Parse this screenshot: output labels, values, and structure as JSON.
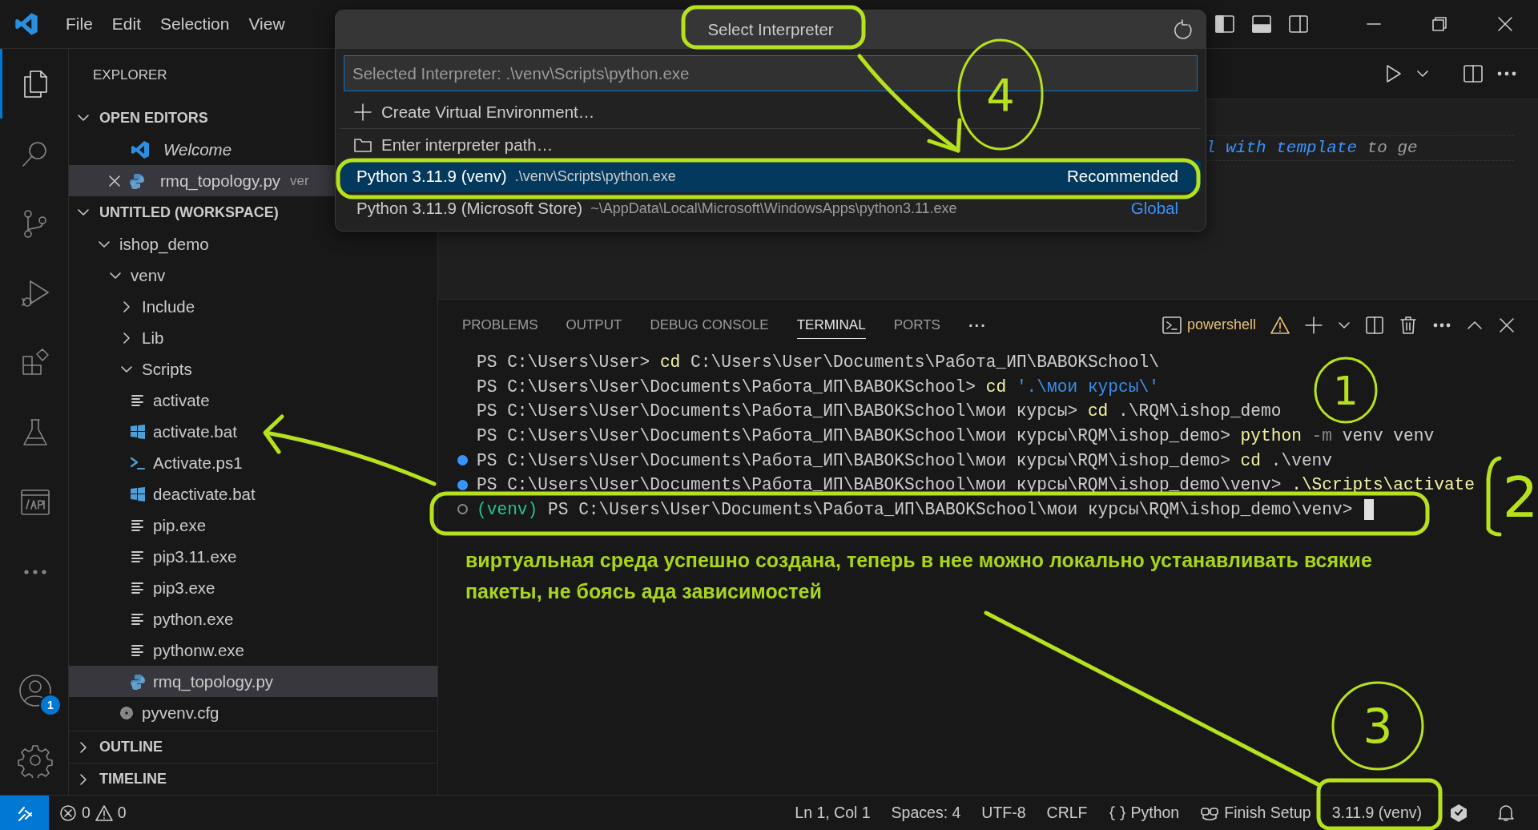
{
  "title_bar": {
    "menu": [
      "File",
      "Edit",
      "Selection",
      "View"
    ]
  },
  "activity_bar": {
    "items": [
      {
        "selected": true
      },
      {
        "selected": false
      },
      {
        "selected": false
      },
      {
        "selected": false
      },
      {
        "selected": false
      },
      {
        "selected": false
      },
      {
        "selected": false
      },
      {
        "selected": false
      }
    ],
    "accounts_badge": "1"
  },
  "sidebar": {
    "title": "EXPLORER",
    "open_editors": {
      "title": "OPEN EDITORS",
      "expanded": true,
      "items": [
        {
          "label": "Welcome",
          "kind": "welcome",
          "italic": true,
          "closable": false,
          "selected": false
        },
        {
          "label": "rmq_topology.py",
          "kind": "python",
          "description": "ver",
          "italic": false,
          "closable": true,
          "selected": true
        }
      ]
    },
    "workspace": {
      "title": "UNTITLED (WORKSPACE)",
      "expanded": true,
      "tree": [
        {
          "label": "ishop_demo",
          "kind": "folder",
          "expanded": true,
          "selected": false,
          "children": [
            {
              "label": "venv",
              "kind": "folder",
              "expanded": true,
              "selected": false,
              "children": [
                {
                  "label": "Include",
                  "kind": "folder",
                  "expanded": false,
                  "selected": false
                },
                {
                  "label": "Lib",
                  "kind": "folder",
                  "expanded": false,
                  "selected": false
                },
                {
                  "label": "Scripts",
                  "kind": "folder",
                  "expanded": true,
                  "selected": false,
                  "children": [
                    {
                      "label": "activate",
                      "kind": "text",
                      "selected": false
                    },
                    {
                      "label": "activate.bat",
                      "kind": "windows",
                      "selected": false
                    },
                    {
                      "label": "Activate.ps1",
                      "kind": "powershell",
                      "selected": false
                    },
                    {
                      "label": "deactivate.bat",
                      "kind": "windows",
                      "selected": false
                    },
                    {
                      "label": "pip.exe",
                      "kind": "text",
                      "selected": false
                    },
                    {
                      "label": "pip3.11.exe",
                      "kind": "text",
                      "selected": false
                    },
                    {
                      "label": "pip3.exe",
                      "kind": "text",
                      "selected": false
                    },
                    {
                      "label": "python.exe",
                      "kind": "text",
                      "selected": false
                    },
                    {
                      "label": "pythonw.exe",
                      "kind": "text",
                      "selected": false
                    },
                    {
                      "label": "rmq_topology.py",
                      "kind": "python",
                      "selected": true
                    }
                  ]
                },
                {
                  "label": "pyvenv.cfg",
                  "kind": "config",
                  "selected": false
                }
              ]
            }
          ]
        }
      ]
    },
    "collapsed_sections": [
      {
        "title": "OUTLINE",
        "expanded": false
      },
      {
        "title": "TIMELINE",
        "expanded": false
      }
    ]
  },
  "editor": {
    "visible_text": [
      {
        "kind": "emphasis",
        "text": "l with template"
      },
      {
        "kind": "plain",
        "text": " to ge"
      }
    ]
  },
  "quick_pick": {
    "title": "Select Interpreter",
    "placeholder": "Selected Interpreter: .\\venv\\Scripts\\python.exe",
    "items": [
      {
        "kind": "create",
        "label": "Create Virtual Environment…",
        "selected": false
      },
      {
        "kind": "browse",
        "label": "Enter interpreter path…",
        "selected": false
      },
      {
        "kind": "interpreter",
        "label": "Python 3.11.9 (venv)",
        "detail": ".\\venv\\Scripts\\python.exe",
        "badge": "Recommended",
        "selected": true
      },
      {
        "kind": "interpreter",
        "label": "Python 3.11.9 (Microsoft Store)",
        "detail": "~\\AppData\\Local\\Microsoft\\WindowsApps\\python3.11.exe",
        "badge": "Global",
        "selected": false
      }
    ]
  },
  "panel": {
    "tabs": [
      {
        "label": "PROBLEMS",
        "selected": false
      },
      {
        "label": "OUTPUT",
        "selected": false
      },
      {
        "label": "DEBUG CONSOLE",
        "selected": false
      },
      {
        "label": "TERMINAL",
        "selected": true
      },
      {
        "label": "PORTS",
        "selected": false
      }
    ],
    "more": "···",
    "shell": "powershell",
    "terminal": {
      "cursor_visible": true,
      "lines": [
        {
          "kind": "plain",
          "segments": [
            {
              "kind": "text",
              "text": "PS C:\\Users\\User> "
            },
            {
              "kind": "command",
              "text": "cd"
            },
            {
              "kind": "text",
              "text": " C:\\Users\\User\\Documents\\Работа_ИП\\BABOKSchool\\"
            }
          ]
        },
        {
          "kind": "plain",
          "segments": [
            {
              "kind": "text",
              "text": "PS C:\\Users\\User\\Documents\\Работа_ИП\\BABOKSchool> "
            },
            {
              "kind": "command",
              "text": "cd"
            },
            {
              "kind": "string",
              "text": " '.\\мои курсы\\'"
            }
          ]
        },
        {
          "kind": "plain",
          "segments": [
            {
              "kind": "text",
              "text": "PS C:\\Users\\User\\Documents\\Работа_ИП\\BABOKSchool\\мои курсы> "
            },
            {
              "kind": "command",
              "text": "cd"
            },
            {
              "kind": "text",
              "text": " .\\RQM\\ishop_demo"
            }
          ]
        },
        {
          "kind": "plain",
          "segments": [
            {
              "kind": "text",
              "text": "PS C:\\Users\\User\\Documents\\Работа_ИП\\BABOKSchool\\мои курсы\\RQM\\ishop_demo> "
            },
            {
              "kind": "command",
              "text": "python"
            },
            {
              "kind": "flag",
              "text": " -m"
            },
            {
              "kind": "text",
              "text": " venv venv"
            }
          ]
        },
        {
          "kind": "success",
          "segments": [
            {
              "kind": "text",
              "text": "PS C:\\Users\\User\\Documents\\Работа_ИП\\BABOKSchool\\мои курсы\\RQM\\ishop_demo> "
            },
            {
              "kind": "command",
              "text": "cd"
            },
            {
              "kind": "text",
              "text": " .\\venv"
            }
          ]
        },
        {
          "kind": "success",
          "segments": [
            {
              "kind": "text",
              "text": "PS C:\\Users\\User\\Documents\\Работа_ИП\\BABOKSchool\\мои курсы\\RQM\\ishop_demo\\venv> "
            },
            {
              "kind": "command",
              "text": ".\\Scripts\\activate"
            }
          ]
        },
        {
          "kind": "pending",
          "segments": [
            {
              "kind": "env",
              "text": "(venv)"
            },
            {
              "kind": "text",
              "text": " PS C:\\Users\\User\\Documents\\Работа_ИП\\BABOKSchool\\мои курсы\\RQM\\ishop_demo\\venv> "
            }
          ]
        }
      ]
    }
  },
  "status_bar": {
    "errors": "0",
    "warnings": "0",
    "items": [
      {
        "kind": "text",
        "label": "Ln 1, Col 1"
      },
      {
        "kind": "text",
        "label": "Spaces: 4"
      },
      {
        "kind": "text",
        "label": "UTF-8"
      },
      {
        "kind": "text",
        "label": "CRLF"
      },
      {
        "kind": "language",
        "label": "Python"
      },
      {
        "kind": "setup",
        "label": "Finish Setup"
      },
      {
        "kind": "text",
        "label": "3.11.9 (venv)"
      }
    ]
  },
  "annotations": {
    "callouts": [
      {
        "label": "4"
      },
      {
        "label": "1"
      },
      {
        "label": "2"
      },
      {
        "label": "3"
      }
    ],
    "note": "виртуальная среда успешно создана, теперь в нее можно локально устанавливать всякие пакеты, не боясь ада зависимостей"
  }
}
